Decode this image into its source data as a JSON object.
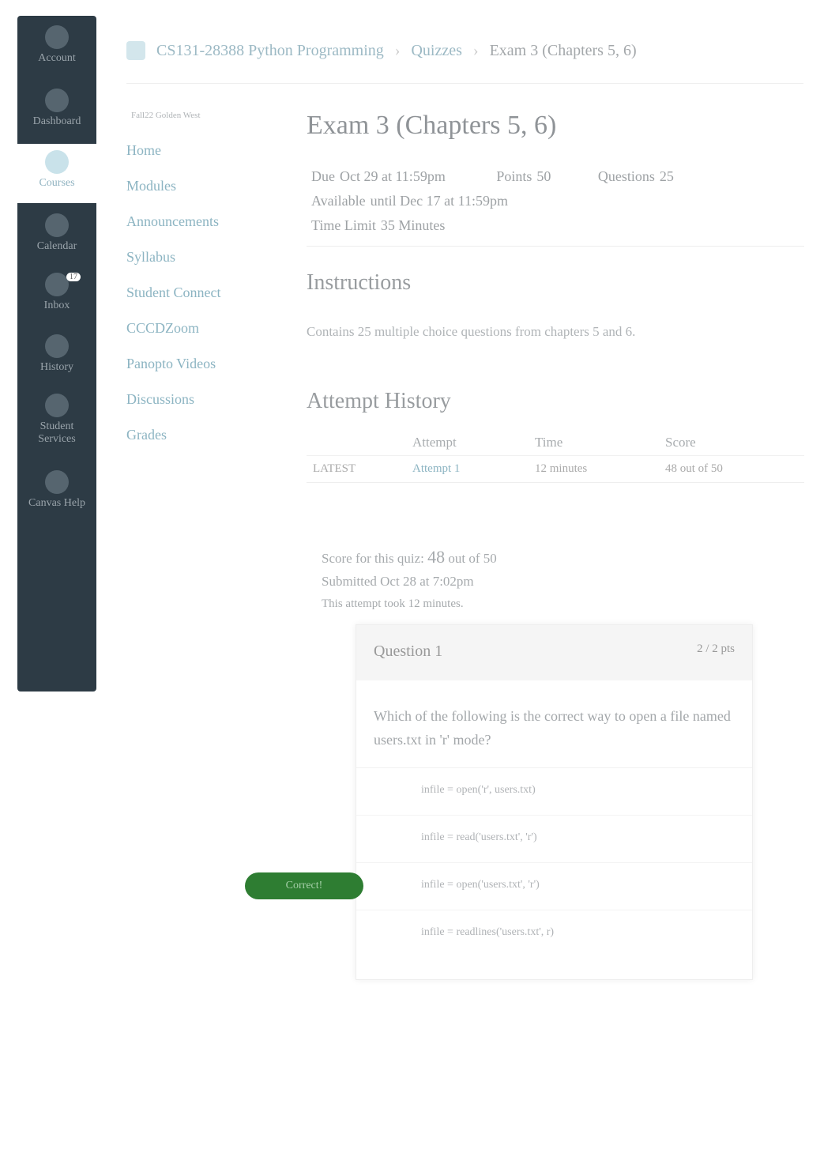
{
  "global_nav": [
    {
      "label": "Account",
      "icon": "user-icon"
    },
    {
      "label": "Dashboard",
      "icon": "dashboard-icon"
    },
    {
      "label": "Courses",
      "icon": "book-icon",
      "active": true
    },
    {
      "label": "Calendar",
      "icon": "calendar-icon"
    },
    {
      "label": "Inbox",
      "icon": "inbox-icon",
      "badge": "17"
    },
    {
      "label": "History",
      "icon": "clock-icon"
    },
    {
      "label": "Student Services",
      "icon": "star-icon"
    },
    {
      "label": "Canvas Help",
      "icon": "help-icon"
    }
  ],
  "breadcrumb": {
    "course": "CS131-28388 Python Programming",
    "section": "Quizzes",
    "current": "Exam 3 (Chapters 5, 6)"
  },
  "course_nav": {
    "term": "Fall22 Golden West",
    "items": [
      "Home",
      "Modules",
      "Announcements",
      "Syllabus",
      "Student Connect",
      "CCCDZoom",
      "Panopto Videos",
      "Discussions",
      "Grades"
    ]
  },
  "quiz": {
    "title": "Exam 3 (Chapters 5, 6)",
    "due_label": "Due",
    "due": "Oct 29 at 11:59pm",
    "points_label": "Points",
    "points": "50",
    "questions_label": "Questions",
    "questions": "25",
    "available_label": "Available",
    "available": "until Dec 17 at 11:59pm",
    "time_limit_label": "Time Limit",
    "time_limit": "35 Minutes",
    "instructions_heading": "Instructions",
    "instructions": "Contains 25 multiple choice questions from chapters 5 and 6."
  },
  "attempts": {
    "heading": "Attempt History",
    "columns": [
      "",
      "Attempt",
      "Time",
      "Score"
    ],
    "rows": [
      {
        "tag": "LATEST",
        "attempt": "Attempt 1",
        "time": "12 minutes",
        "score": "48 out of 50"
      }
    ]
  },
  "summary": {
    "score_label": "Score for this quiz:",
    "score": "48",
    "score_out": "out of 50",
    "submitted": "Submitted Oct 28 at 7:02pm",
    "duration": "This attempt took 12 minutes."
  },
  "question": {
    "title": "Question 1",
    "points": "2 / 2 pts",
    "text": "Which of the following is the correct way to open a file named users.txt in 'r' mode?",
    "answers": [
      "infile = open('r', users.txt)",
      "infile = read('users.txt', 'r')",
      "infile = open('users.txt', 'r')",
      "infile = readlines('users.txt', r)"
    ],
    "correct_label": "Correct!",
    "accent": "#2e7d32"
  }
}
